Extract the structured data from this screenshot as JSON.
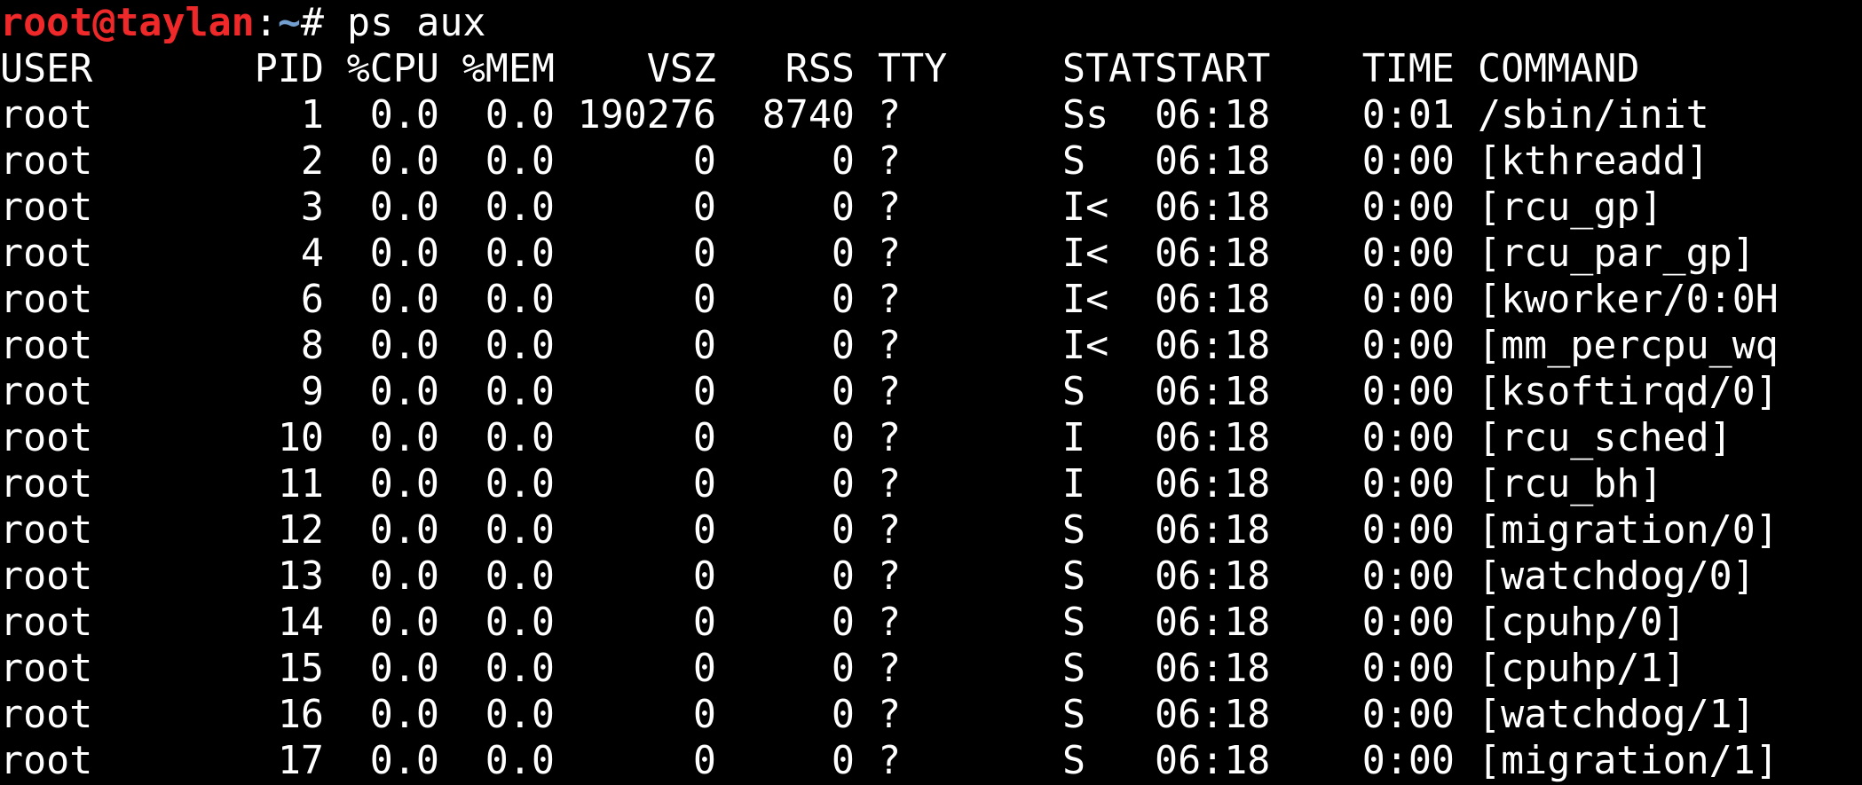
{
  "terminal": {
    "prompt_user_host": "root@taylan",
    "prompt_colon": ":",
    "prompt_path": "~",
    "prompt_symbol": "#",
    "command": " ps aux",
    "colors": {
      "background": "#000000",
      "text": "#ffffff",
      "prompt_user": "#ef2929",
      "prompt_path": "#729fcf"
    }
  },
  "table": {
    "headers": {
      "user": "USER",
      "pid": "PID",
      "cpu": "%CPU",
      "mem": "%MEM",
      "vsz": "VSZ",
      "rss": "RSS",
      "tty": "TTY",
      "stat": "STAT",
      "start": "START",
      "time": "TIME",
      "command": "COMMAND"
    },
    "rows": [
      {
        "user": "root",
        "pid": "1",
        "cpu": "0.0",
        "mem": "0.0",
        "vsz": "190276",
        "rss": "8740",
        "tty": "?",
        "stat": "Ss",
        "start": "06:18",
        "time": "0:01",
        "command": "/sbin/init"
      },
      {
        "user": "root",
        "pid": "2",
        "cpu": "0.0",
        "mem": "0.0",
        "vsz": "0",
        "rss": "0",
        "tty": "?",
        "stat": "S",
        "start": "06:18",
        "time": "0:00",
        "command": "[kthreadd]"
      },
      {
        "user": "root",
        "pid": "3",
        "cpu": "0.0",
        "mem": "0.0",
        "vsz": "0",
        "rss": "0",
        "tty": "?",
        "stat": "I<",
        "start": "06:18",
        "time": "0:00",
        "command": "[rcu_gp]"
      },
      {
        "user": "root",
        "pid": "4",
        "cpu": "0.0",
        "mem": "0.0",
        "vsz": "0",
        "rss": "0",
        "tty": "?",
        "stat": "I<",
        "start": "06:18",
        "time": "0:00",
        "command": "[rcu_par_gp]"
      },
      {
        "user": "root",
        "pid": "6",
        "cpu": "0.0",
        "mem": "0.0",
        "vsz": "0",
        "rss": "0",
        "tty": "?",
        "stat": "I<",
        "start": "06:18",
        "time": "0:00",
        "command": "[kworker/0:0H"
      },
      {
        "user": "root",
        "pid": "8",
        "cpu": "0.0",
        "mem": "0.0",
        "vsz": "0",
        "rss": "0",
        "tty": "?",
        "stat": "I<",
        "start": "06:18",
        "time": "0:00",
        "command": "[mm_percpu_wq"
      },
      {
        "user": "root",
        "pid": "9",
        "cpu": "0.0",
        "mem": "0.0",
        "vsz": "0",
        "rss": "0",
        "tty": "?",
        "stat": "S",
        "start": "06:18",
        "time": "0:00",
        "command": "[ksoftirqd/0]"
      },
      {
        "user": "root",
        "pid": "10",
        "cpu": "0.0",
        "mem": "0.0",
        "vsz": "0",
        "rss": "0",
        "tty": "?",
        "stat": "I",
        "start": "06:18",
        "time": "0:00",
        "command": "[rcu_sched]"
      },
      {
        "user": "root",
        "pid": "11",
        "cpu": "0.0",
        "mem": "0.0",
        "vsz": "0",
        "rss": "0",
        "tty": "?",
        "stat": "I",
        "start": "06:18",
        "time": "0:00",
        "command": "[rcu_bh]"
      },
      {
        "user": "root",
        "pid": "12",
        "cpu": "0.0",
        "mem": "0.0",
        "vsz": "0",
        "rss": "0",
        "tty": "?",
        "stat": "S",
        "start": "06:18",
        "time": "0:00",
        "command": "[migration/0]"
      },
      {
        "user": "root",
        "pid": "13",
        "cpu": "0.0",
        "mem": "0.0",
        "vsz": "0",
        "rss": "0",
        "tty": "?",
        "stat": "S",
        "start": "06:18",
        "time": "0:00",
        "command": "[watchdog/0]"
      },
      {
        "user": "root",
        "pid": "14",
        "cpu": "0.0",
        "mem": "0.0",
        "vsz": "0",
        "rss": "0",
        "tty": "?",
        "stat": "S",
        "start": "06:18",
        "time": "0:00",
        "command": "[cpuhp/0]"
      },
      {
        "user": "root",
        "pid": "15",
        "cpu": "0.0",
        "mem": "0.0",
        "vsz": "0",
        "rss": "0",
        "tty": "?",
        "stat": "S",
        "start": "06:18",
        "time": "0:00",
        "command": "[cpuhp/1]"
      },
      {
        "user": "root",
        "pid": "16",
        "cpu": "0.0",
        "mem": "0.0",
        "vsz": "0",
        "rss": "0",
        "tty": "?",
        "stat": "S",
        "start": "06:18",
        "time": "0:00",
        "command": "[watchdog/1]"
      },
      {
        "user": "root",
        "pid": "17",
        "cpu": "0.0",
        "mem": "0.0",
        "vsz": "0",
        "rss": "0",
        "tty": "?",
        "stat": "S",
        "start": "06:18",
        "time": "0:00",
        "command": "[migration/1]"
      }
    ]
  }
}
